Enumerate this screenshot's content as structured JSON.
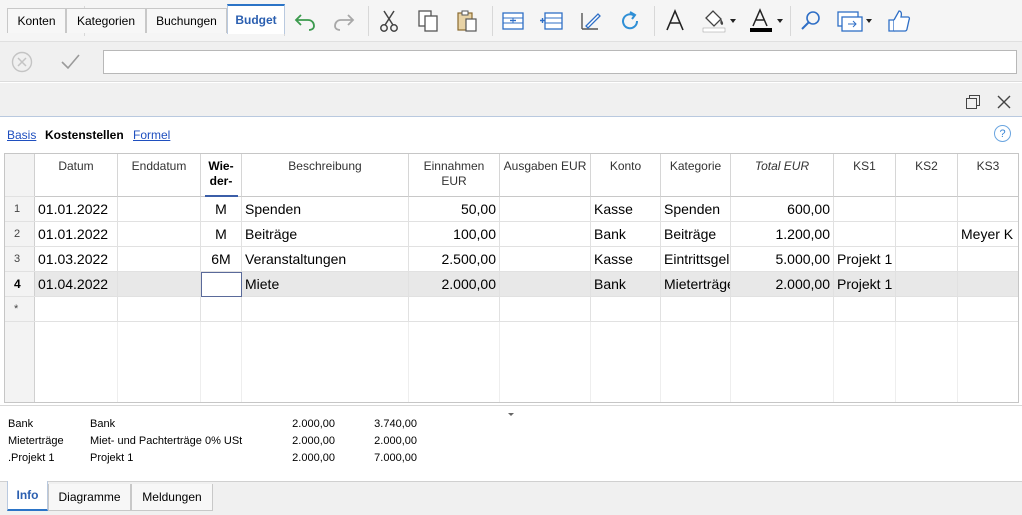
{
  "toolbar_icons": [
    "back-icon",
    "forward-icon",
    "new-file-icon",
    "open-folder-icon",
    "save-icon",
    "pdf-icon",
    "print-icon",
    "undo-icon",
    "redo-icon",
    "cut-icon",
    "copy-icon",
    "paste-icon",
    "insert-row-icon",
    "add-rows-icon",
    "edit-icon",
    "refresh-icon",
    "font-icon",
    "fill-color-icon",
    "text-color-icon",
    "search-icon",
    "windows-icon",
    "thumbs-up-icon"
  ],
  "formula_bar": {
    "value": ""
  },
  "tabs": [
    {
      "label": "Konten"
    },
    {
      "label": "Kategorien"
    },
    {
      "label": "Buchungen"
    },
    {
      "label": "Budget"
    }
  ],
  "views": {
    "basis": "Basis",
    "kostenstellen": "Kostenstellen",
    "formel": "Formel"
  },
  "help_symbol": "?",
  "grid": {
    "headers": [
      [
        "Datum"
      ],
      [
        "Enddatum"
      ],
      [
        "Wie-",
        "der-"
      ],
      [
        "Beschreibung"
      ],
      [
        "Einnahmen",
        "EUR"
      ],
      [
        "Ausgaben EUR"
      ],
      [
        "Konto"
      ],
      [
        "Kategorie"
      ],
      [
        "Total EUR"
      ],
      [
        "KS1"
      ],
      [
        "KS2"
      ],
      [
        "KS3"
      ]
    ],
    "rows": [
      {
        "num": "1",
        "cells": [
          "01.01.2022",
          "",
          "M",
          "Spenden",
          "50,00",
          "",
          "Kasse",
          "Spenden",
          "600,00",
          "",
          "",
          ""
        ]
      },
      {
        "num": "2",
        "cells": [
          "01.01.2022",
          "",
          "M",
          "Beiträge",
          "100,00",
          "",
          "Bank",
          "Beiträge",
          "1.200,00",
          "",
          "",
          "Meyer K"
        ]
      },
      {
        "num": "3",
        "cells": [
          "01.03.2022",
          "",
          "6M",
          "Veranstaltungen",
          "2.500,00",
          "",
          "Kasse",
          "Eintrittsgeld",
          "5.000,00",
          "Projekt 1",
          "",
          ""
        ]
      },
      {
        "num": "4",
        "cells": [
          "01.04.2022",
          "",
          "",
          "Miete",
          "2.000,00",
          "",
          "Bank",
          "Mieterträge",
          "2.000,00",
          "Projekt 1",
          "",
          ""
        ]
      },
      {
        "num": "*",
        "cells": [
          "",
          "",
          "",
          "",
          "",
          "",
          "",
          "",
          "",
          "",
          "",
          ""
        ]
      }
    ]
  },
  "info_rows": [
    [
      "Bank",
      "Bank",
      "2.000,00",
      "3.740,00"
    ],
    [
      "Mieterträge",
      "Miet- und Pachterträge 0% USt",
      "2.000,00",
      "2.000,00"
    ],
    [
      ".Projekt 1",
      "Projekt 1",
      "2.000,00",
      "7.000,00"
    ]
  ],
  "bottom_tabs": [
    {
      "label": "Info"
    },
    {
      "label": "Diagramme"
    },
    {
      "label": "Meldungen"
    }
  ],
  "colors": {
    "accent": "#2b74c7",
    "link": "#1f4fbf",
    "pdf_red": "#d9322b",
    "save_purple": "#b04a9a",
    "folder_orange": "#f0a030"
  }
}
